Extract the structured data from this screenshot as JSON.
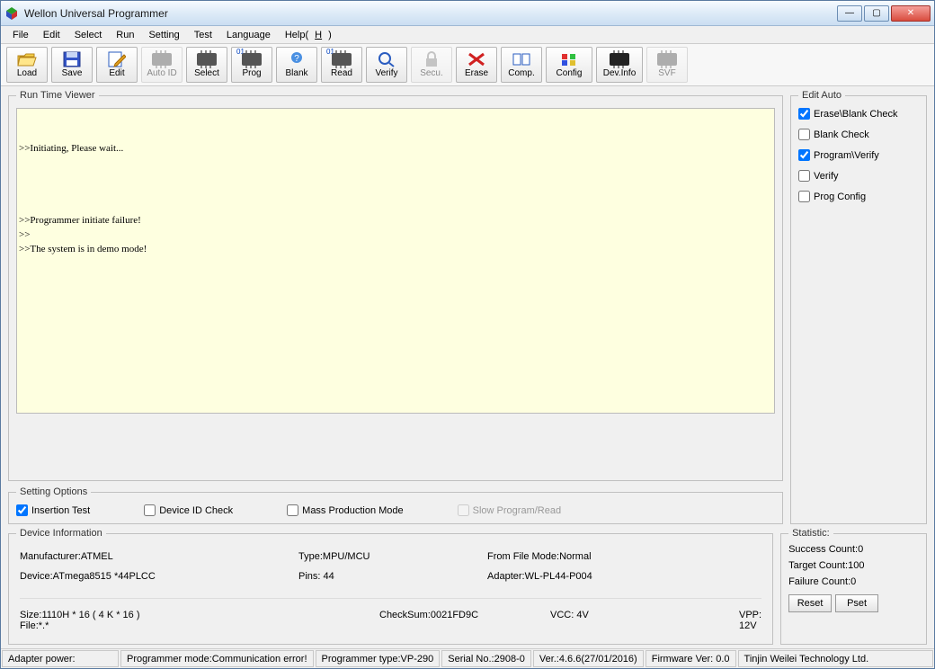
{
  "title": "Wellon Universal Programmer",
  "menu": [
    "File",
    "Edit",
    "Select",
    "Run",
    "Setting",
    "Test",
    "Language",
    "Help(H)"
  ],
  "toolbar": [
    {
      "id": "load",
      "label": "Load"
    },
    {
      "id": "save",
      "label": "Save"
    },
    {
      "id": "edit",
      "label": "Edit"
    },
    {
      "id": "autoid",
      "label": "Auto ID",
      "disabled": true
    },
    {
      "id": "select",
      "label": "Select"
    },
    {
      "id": "prog",
      "label": "Prog",
      "badge": "01"
    },
    {
      "id": "blank",
      "label": "Blank"
    },
    {
      "id": "read",
      "label": "Read",
      "badge": "01"
    },
    {
      "id": "verify",
      "label": "Verify"
    },
    {
      "id": "secu",
      "label": "Secu.",
      "disabled": true
    },
    {
      "id": "erase",
      "label": "Erase"
    },
    {
      "id": "comp",
      "label": "Comp."
    },
    {
      "id": "config",
      "label": "Config"
    },
    {
      "id": "devinfo",
      "label": "Dev.Info"
    },
    {
      "id": "svf",
      "label": "SVF",
      "disabled": true
    }
  ],
  "runTimeViewer": {
    "legend": "Run Time Viewer",
    "text": "\n\n>>Initiating, Please wait...\n\n\n\n\n>>Programmer initiate failure!\n>>\n>>The system is in demo mode!"
  },
  "settingOptions": {
    "legend": "Setting Options",
    "items": [
      {
        "label": "Insertion Test",
        "checked": true
      },
      {
        "label": "Device ID Check",
        "checked": false
      },
      {
        "label": "Mass Production Mode",
        "checked": false
      },
      {
        "label": "Slow Program/Read",
        "checked": false,
        "disabled": true
      }
    ]
  },
  "editAuto": {
    "legend": "Edit Auto",
    "items": [
      {
        "label": "Erase\\Blank Check",
        "checked": true
      },
      {
        "label": "Blank Check",
        "checked": false
      },
      {
        "label": "Program\\Verify",
        "checked": true
      },
      {
        "label": "Verify",
        "checked": false
      },
      {
        "label": "Prog Config",
        "checked": false
      }
    ]
  },
  "deviceInfo": {
    "legend": "Device Information",
    "row1": {
      "manufacturer": "Manufacturer:ATMEL",
      "type": "Type:MPU/MCU",
      "fromfile": "From File Mode:Normal"
    },
    "row2": {
      "device": "Device:ATmega8515 *44PLCC",
      "pins": "Pins: 44",
      "adapter": "Adapter:WL-PL44-P004"
    },
    "row3": {
      "size": "Size:1110H * 16 ( 4 K * 16 )",
      "file": "File:*.*",
      "checksum": "CheckSum:0021FD9C",
      "vcc": "VCC: 4V",
      "vpp": "VPP: 12V"
    }
  },
  "statistic": {
    "legend": "Statistic:",
    "success": "Success Count:0",
    "target": "Target Count:100",
    "failure": "Failure Count:0",
    "reset": "Reset",
    "pset": "Pset"
  },
  "status": {
    "adapter": "Adapter power:",
    "mode": "Programmer mode:Communication error!",
    "type": "Programmer type:VP-290",
    "serial": "Serial No.:2908-0",
    "ver": "Ver.:4.6.6(27/01/2016)",
    "fw": "Firmware Ver: 0.0",
    "company": "Tinjin Weilei Technology Ltd."
  }
}
